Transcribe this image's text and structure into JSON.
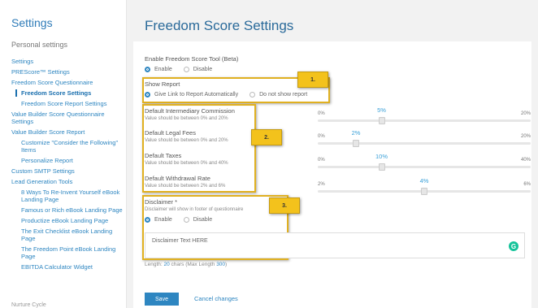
{
  "sidebar": {
    "title": "Settings",
    "section": "Personal settings",
    "items": [
      {
        "label": "Settings",
        "level": 0
      },
      {
        "label": "PREScore™ Settings",
        "level": 0
      },
      {
        "label": "Freedom Score Questionnaire",
        "level": 0
      },
      {
        "label": "Freedom Score Settings",
        "level": 1,
        "active": true
      },
      {
        "label": "Freedom Score Report Settings",
        "level": 1
      },
      {
        "label": "Value Builder Score Questionnaire Settings",
        "level": 0
      },
      {
        "label": "Value Builder Score Report",
        "level": 0
      },
      {
        "label": "Customize \"Consider the Following\" Items",
        "level": 1
      },
      {
        "label": "Personalize Report",
        "level": 1
      },
      {
        "label": "Custom SMTP Settings",
        "level": 0
      },
      {
        "label": "Lead Generation Tools",
        "level": 0
      },
      {
        "label": "8 Ways To Re-Invent Yourself eBook Landing Page",
        "level": 1
      },
      {
        "label": "Famous or Rich eBook Landing Page",
        "level": 1
      },
      {
        "label": "Productize eBook Landing Page",
        "level": 1
      },
      {
        "label": "The Exit Checklist eBook Landing Page",
        "level": 1
      },
      {
        "label": "The Freedom Point eBook Landing Page",
        "level": 1
      },
      {
        "label": "EBITDA Calculator Widget",
        "level": 1
      }
    ],
    "footer": "Nurture Cycle"
  },
  "page": {
    "title": "Freedom Score Settings"
  },
  "enable_tool": {
    "label": "Enable Freedom Score Tool (Beta)",
    "options": [
      "Enable",
      "Disable"
    ],
    "selected": "Enable"
  },
  "show_report": {
    "label": "Show Report",
    "options": [
      "Give Link to Report Automatically",
      "Do not show report"
    ],
    "selected": "Give Link to Report Automatically"
  },
  "sliders": [
    {
      "label": "Default Intermediary Commission",
      "hint": "Value should be between 0% and 20%",
      "min_label": "0%",
      "max_label": "20%",
      "min": 0,
      "max": 20,
      "value": 5,
      "value_label": "5%"
    },
    {
      "label": "Default Legal Fees",
      "hint": "Value should be between 0% and 20%",
      "min_label": "0%",
      "max_label": "20%",
      "min": 0,
      "max": 20,
      "value": 2,
      "value_label": "2%"
    },
    {
      "label": "Default Taxes",
      "hint": "Value should be between 0% and 40%",
      "min_label": "0%",
      "max_label": "40%",
      "min": 0,
      "max": 40,
      "value": 10,
      "value_label": "10%"
    },
    {
      "label": "Default Withdrawal Rate",
      "hint": "Value should be between 2% and 6%",
      "min_label": "2%",
      "max_label": "6%",
      "min": 2,
      "max": 6,
      "value": 4,
      "value_label": "4%"
    }
  ],
  "disclaimer": {
    "label": "Disclaimer *",
    "hint": "Disclaimer will show in footer of questionnaire",
    "options": [
      "Enable",
      "Disable"
    ],
    "selected": "Enable",
    "text": "Disclaimer Text HERE",
    "length_prefix": "Length: ",
    "length_value": "20",
    "length_mid": " chars (Max Length ",
    "length_max": "300",
    "length_suffix": ")"
  },
  "callouts": [
    "1.",
    "2.",
    "3."
  ],
  "actions": {
    "save": "Save",
    "cancel": "Cancel changes"
  },
  "colors": {
    "accent": "#2e86c1",
    "highlight": "#f3c21c",
    "grammarly": "#15c39a"
  }
}
